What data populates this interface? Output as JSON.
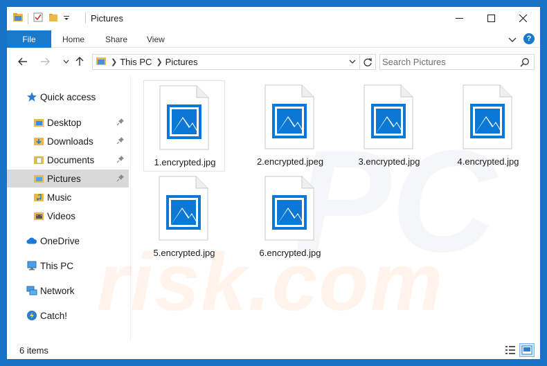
{
  "window": {
    "title": "Pictures"
  },
  "ribbon": {
    "tabs": [
      {
        "label": "File"
      },
      {
        "label": "Home"
      },
      {
        "label": "Share"
      },
      {
        "label": "View"
      }
    ],
    "help": "?"
  },
  "address_bar": {
    "path": [
      "This PC",
      "Pictures"
    ]
  },
  "search": {
    "placeholder": "Search Pictures"
  },
  "sidebar": {
    "items": [
      {
        "label": "Quick access",
        "icon": "star-icon",
        "pinned": false
      },
      {
        "label": "Desktop",
        "icon": "desktop-folder-icon",
        "pinned": true
      },
      {
        "label": "Downloads",
        "icon": "downloads-folder-icon",
        "pinned": true
      },
      {
        "label": "Documents",
        "icon": "documents-folder-icon",
        "pinned": true
      },
      {
        "label": "Pictures",
        "icon": "pictures-folder-icon",
        "pinned": true,
        "selected": true
      },
      {
        "label": "Music",
        "icon": "music-folder-icon",
        "pinned": false
      },
      {
        "label": "Videos",
        "icon": "videos-folder-icon",
        "pinned": false
      },
      {
        "label": "OneDrive",
        "icon": "cloud-icon",
        "pinned": false
      },
      {
        "label": "This PC",
        "icon": "computer-icon",
        "pinned": false
      },
      {
        "label": "Network",
        "icon": "network-icon",
        "pinned": false
      },
      {
        "label": "Catch!",
        "icon": "catch-icon",
        "pinned": false
      }
    ]
  },
  "files": [
    {
      "name": "1.encrypted.jpg",
      "icon": "image-file-icon",
      "selected": true
    },
    {
      "name": "2.encrypted.jpeg",
      "icon": "image-file-icon"
    },
    {
      "name": "3.encrypted.jpg",
      "icon": "image-file-icon"
    },
    {
      "name": "4.encrypted.jpg",
      "icon": "image-file-icon"
    },
    {
      "name": "5.encrypted.jpg",
      "icon": "image-file-icon"
    },
    {
      "name": "6.encrypted.jpg",
      "icon": "image-file-icon"
    }
  ],
  "status": {
    "item_count": "6 items"
  },
  "colors": {
    "accent": "#1979ca",
    "image_icon": "#0a78d4",
    "selected_nav": "#d9d9d9"
  }
}
